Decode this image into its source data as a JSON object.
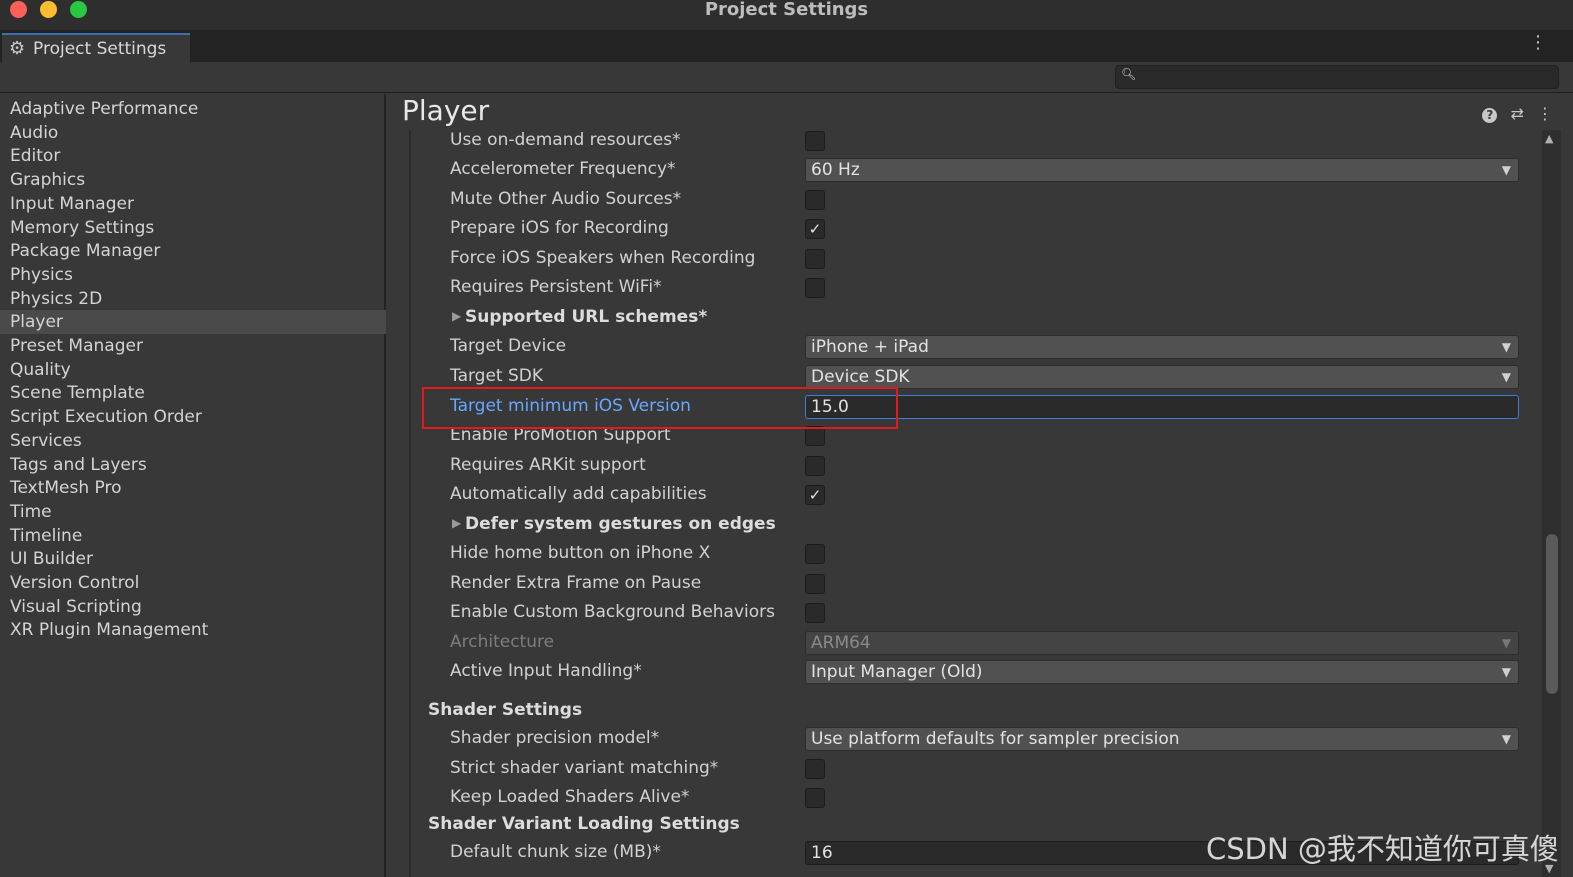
{
  "window": {
    "title": "Project Settings"
  },
  "tab": {
    "label": "Project Settings"
  },
  "search": {
    "placeholder": ""
  },
  "sidebar": {
    "items": [
      "Adaptive Performance",
      "Audio",
      "Editor",
      "Graphics",
      "Input Manager",
      "Memory Settings",
      "Package Manager",
      "Physics",
      "Physics 2D",
      "Player",
      "Preset Manager",
      "Quality",
      "Scene Template",
      "Script Execution Order",
      "Services",
      "Tags and Layers",
      "TextMesh Pro",
      "Time",
      "Timeline",
      "UI Builder",
      "Version Control",
      "Visual Scripting",
      "XR Plugin Management"
    ],
    "selected": "Player"
  },
  "main": {
    "title": "Player",
    "rows": [
      {
        "label": "Use on-demand resources*",
        "type": "checkbox",
        "checked": false
      },
      {
        "label": "Accelerometer Frequency*",
        "type": "dropdown",
        "value": "60 Hz"
      },
      {
        "label": "Mute Other Audio Sources*",
        "type": "checkbox",
        "checked": false
      },
      {
        "label": "Prepare iOS for Recording",
        "type": "checkbox",
        "checked": true
      },
      {
        "label": "Force iOS Speakers when Recording",
        "type": "checkbox",
        "checked": false
      },
      {
        "label": "Requires Persistent WiFi*",
        "type": "checkbox",
        "checked": false
      },
      {
        "label": "Supported URL schemes*",
        "type": "foldout"
      },
      {
        "label": "Target Device",
        "type": "dropdown",
        "value": "iPhone + iPad"
      },
      {
        "label": "Target SDK",
        "type": "dropdown",
        "value": "Device SDK"
      },
      {
        "label": "Target minimum iOS Version",
        "type": "text",
        "value": "15.0",
        "focused": true
      },
      {
        "label": "Enable ProMotion Support",
        "type": "checkbox",
        "checked": false
      },
      {
        "label": "Requires ARKit support",
        "type": "checkbox",
        "checked": false
      },
      {
        "label": "Automatically add capabilities",
        "type": "checkbox",
        "checked": true
      },
      {
        "label": "Defer system gestures on edges",
        "type": "foldout"
      },
      {
        "label": "Hide home button on iPhone X",
        "type": "checkbox",
        "checked": false
      },
      {
        "label": "Render Extra Frame on Pause",
        "type": "checkbox",
        "checked": false
      },
      {
        "label": "Enable Custom Background Behaviors",
        "type": "checkbox",
        "checked": false
      },
      {
        "label": "Architecture",
        "type": "dropdown",
        "value": "ARM64",
        "disabled": true
      },
      {
        "label": "Active Input Handling*",
        "type": "dropdown",
        "value": "Input Manager (Old)"
      },
      {
        "label": "Shader Settings",
        "type": "header"
      },
      {
        "label": "Shader precision model*",
        "type": "dropdown",
        "value": "Use platform defaults for sampler precision"
      },
      {
        "label": "Strict shader variant matching*",
        "type": "checkbox",
        "checked": false
      },
      {
        "label": "Keep Loaded Shaders Alive*",
        "type": "checkbox",
        "checked": false
      },
      {
        "label": "Shader Variant Loading Settings",
        "type": "header"
      },
      {
        "label": "Default chunk size (MB)*",
        "type": "text",
        "value": "16"
      }
    ]
  },
  "watermark": "CSDN @我不知道你可真傻",
  "colors": {
    "accent": "#3a72b0",
    "active_label": "#67a8ff",
    "highlight": "#e01b1b"
  }
}
